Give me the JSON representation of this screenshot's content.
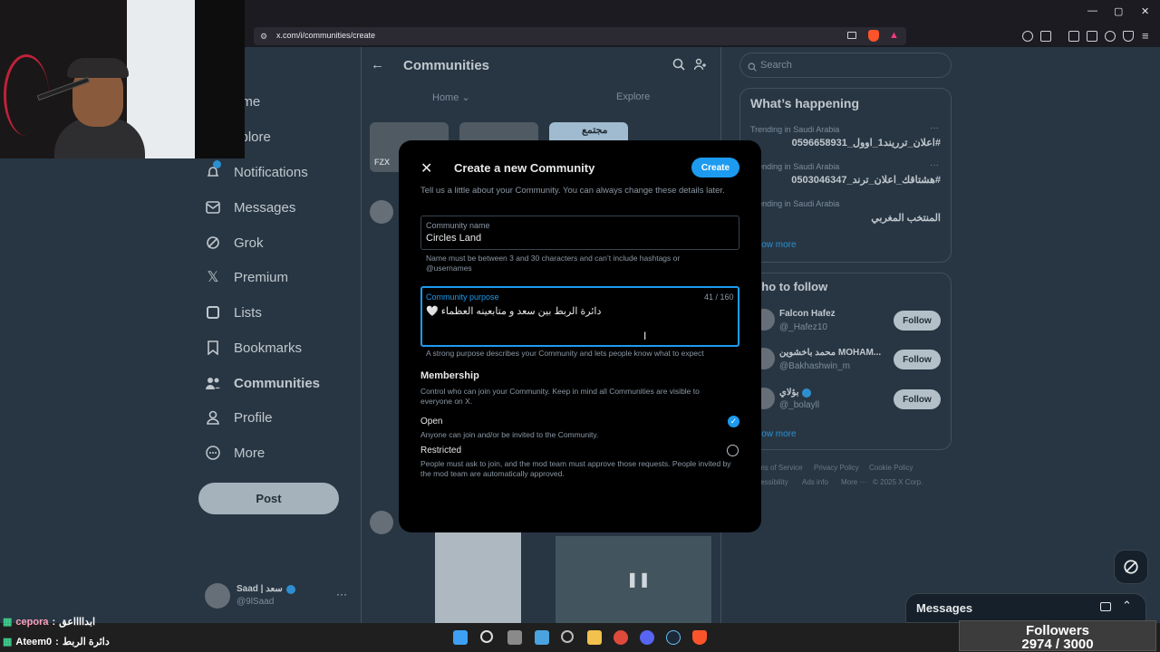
{
  "browser": {
    "url": "x.com/i/communities/create",
    "window_controls": [
      "—",
      "▢",
      "✕"
    ]
  },
  "sidebar": {
    "items": [
      {
        "label": "Home",
        "icon": "home-icon",
        "visible_label": "ome"
      },
      {
        "label": "Explore",
        "icon": "explore-icon",
        "visible_label": "xplore"
      },
      {
        "label": "Notifications",
        "icon": "bell-icon"
      },
      {
        "label": "Messages",
        "icon": "mail-icon"
      },
      {
        "label": "Grok",
        "icon": "grok-icon"
      },
      {
        "label": "Premium",
        "icon": "x-logo-icon"
      },
      {
        "label": "Lists",
        "icon": "list-icon"
      },
      {
        "label": "Bookmarks",
        "icon": "bookmark-icon"
      },
      {
        "label": "Communities",
        "icon": "communities-icon"
      },
      {
        "label": "Profile",
        "icon": "person-icon"
      },
      {
        "label": "More",
        "icon": "more-circle-icon"
      }
    ],
    "post_label": "Post",
    "account": {
      "name": "Saad | سعد",
      "handle": "@9lSaad"
    }
  },
  "middle": {
    "back": "←",
    "title": "Communities",
    "tabs": [
      "Home",
      "Explore"
    ],
    "card_labels": [
      "FZX",
      "مجتمع"
    ]
  },
  "right": {
    "search_placeholder": "Search",
    "trending_title": "What’s happening",
    "trends": [
      {
        "context": "Trending in Saudi Arabia",
        "name": "#اعلان_ترريند1_اوول_0596658931"
      },
      {
        "context": "Trending in Saudi Arabia",
        "name": "#هشتاقك_اعلان_ترند_0503046347"
      },
      {
        "context": "Trending in Saudi Arabia",
        "name": "المنتخب المغربي"
      }
    ],
    "show_more": "Show more",
    "who_to_follow_title": "Who to follow",
    "follow_suggestions": [
      {
        "name": "Falcon Hafez",
        "handle": "@_Hafez10"
      },
      {
        "name": "محمد باخشوين MOHAM...",
        "handle": "@Bakhashwin_m"
      },
      {
        "name": "بؤلاي",
        "handle": "@_bolayll"
      }
    ],
    "follow_label": "Follow",
    "footer_links": [
      "Terms of Service",
      "Privacy Policy",
      "Cookie Policy",
      "Accessibility",
      "Ads info",
      "More ···",
      "© 2025 X Corp."
    ]
  },
  "modal": {
    "title": "Create a new Community",
    "create_label": "Create",
    "intro": "Tell us a little about your Community. You can always change these details later.",
    "name_label": "Community name",
    "name_value": "Circles Land",
    "name_help": "Name must be between 3 and 30 characters and can’t include hashtags or @usernames",
    "purpose_label": "Community purpose",
    "purpose_count": "41 / 160",
    "purpose_value": "دائرة الربط بين سعد و متابعينه العظماء 🤍",
    "purpose_help": "A strong purpose describes your Community and lets people know what to expect",
    "membership_title": "Membership",
    "membership_desc": "Control who can join your Community. Keep in mind all Communities are visible to everyone on X.",
    "options": [
      {
        "label": "Open",
        "desc": "Anyone can join and/or be invited to the Community.",
        "selected": true
      },
      {
        "label": "Restricted",
        "desc": "People must ask to join, and the mod team must approve those requests. People invited by the mod team are automatically approved.",
        "selected": false
      }
    ]
  },
  "messages_drawer": {
    "title": "Messages"
  },
  "stream": {
    "followers_label": "Followers",
    "followers_count": "2974 / 3000",
    "chat": [
      {
        "user": "cepora",
        "text": "ابدااااعق"
      },
      {
        "user": "Ateem0",
        "text": "دائرة الربط"
      }
    ]
  },
  "colors": {
    "accent": "#1d9bf0",
    "background": "#15202b",
    "modal": "#000000",
    "border": "#38444d"
  }
}
